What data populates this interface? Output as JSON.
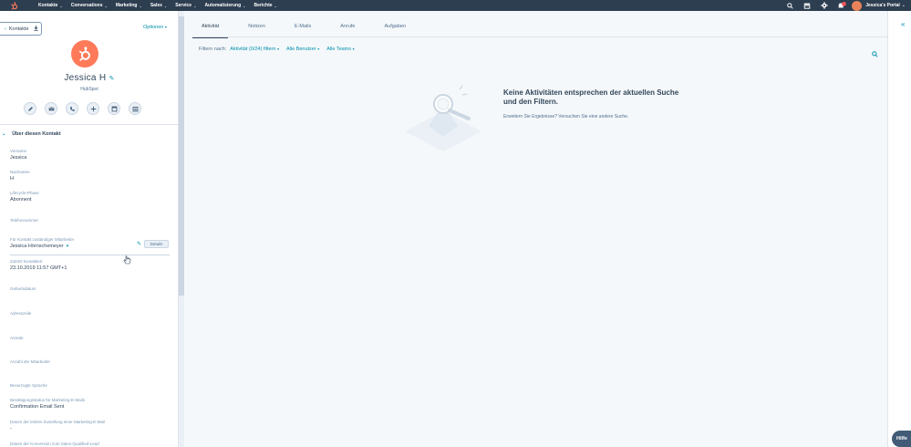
{
  "topnav": {
    "items": [
      {
        "label": "Kontakte"
      },
      {
        "label": "Conversations"
      },
      {
        "label": "Marketing"
      },
      {
        "label": "Sales"
      },
      {
        "label": "Service"
      },
      {
        "label": "Automatisierung"
      },
      {
        "label": "Berichte"
      }
    ],
    "portal": "Jessica's Portal",
    "notification_count": "2"
  },
  "sidebar": {
    "back_button": "Kontakte",
    "options": "Optionen",
    "contact_name": "Jessica H",
    "company": "HubSpot",
    "actions": [
      "note-icon",
      "email-icon",
      "call-icon",
      "add-icon",
      "task-icon",
      "meeting-icon"
    ],
    "section_title": "Über diesen Kontakt",
    "properties": [
      {
        "label": "Vorname",
        "value": "Jessica"
      },
      {
        "label": "Nachname",
        "value": "H"
      },
      {
        "label": "Lifecycle-Phase",
        "value": "Abonnent"
      },
      {
        "label": "Telefonnummer",
        "value": ""
      },
      {
        "label": "Für Kontakt zuständiger Mitarbeiter",
        "value": "Jessica Hörnschemeyer"
      },
      {
        "label": "Zuletzt kontaktiert",
        "value": "23.10.2019 11:57 GMT+1"
      },
      {
        "label": "Geburtsdatum",
        "value": ""
      },
      {
        "label": "Adresszeile",
        "value": ""
      },
      {
        "label": "Anrede",
        "value": ""
      },
      {
        "label": "Anzahl der Mitarbeiter",
        "value": ""
      },
      {
        "label": "Bevorzugte Sprache",
        "value": ""
      },
      {
        "label": "Bestätigungsstatus für Marketing-E-Mails",
        "value": "Confirmation Email Sent"
      },
      {
        "label": "Datum der letzten Zustellung einer Marketing-E-Mail",
        "value": "-"
      },
      {
        "label": "Datum der Konversion zum Sales-Qualified-Lead",
        "value": ""
      }
    ],
    "details_button": "Details"
  },
  "main": {
    "tabs": [
      "Aktivität",
      "Notizen",
      "E-Mails",
      "Anrufe",
      "Aufgaben"
    ],
    "active_tab": "Aktivität",
    "filter_label": "Filtern nach:",
    "filters": [
      "Aktivität (0/24) filtern",
      "Alle Benutzer",
      "Alle Teams"
    ],
    "empty_title": "Keine Aktivitäten entsprechen der aktuellen Suche und den Filtern.",
    "empty_subtitle": "Erweitern Sie Ergebnisse? Versuchen Sie eine andere Suche."
  },
  "help": "Hilfe",
  "colors": {
    "nav_bg": "#2d3e50",
    "accent": "#0091ae",
    "brand": "#ff7a59"
  }
}
